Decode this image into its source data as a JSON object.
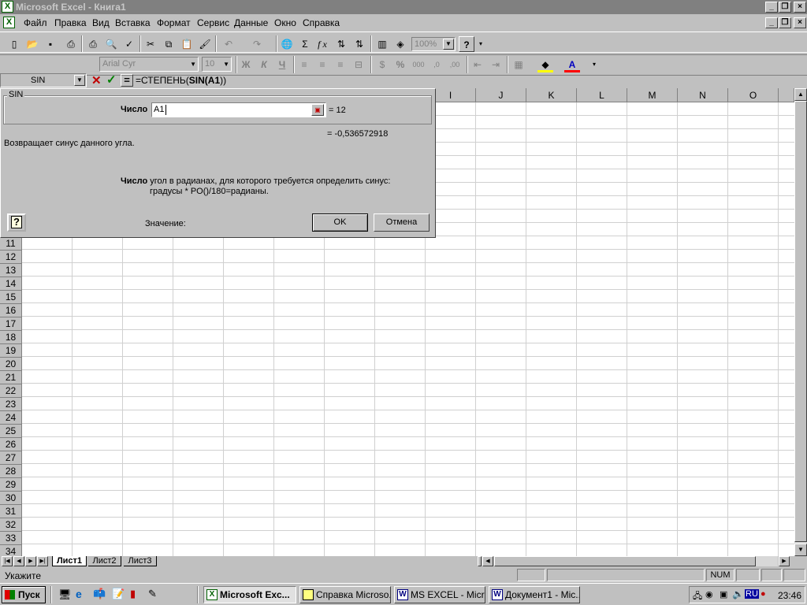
{
  "window": {
    "title": "Microsoft Excel - Книга1"
  },
  "menu": [
    "Файл",
    "Правка",
    "Вид",
    "Вставка",
    "Формат",
    "Сервис",
    "Данные",
    "Окно",
    "Справка"
  ],
  "toolbar": {
    "zoom": "100%",
    "font": "Arial Cyr",
    "size": "10",
    "bold": "Ж",
    "italic": "К",
    "underline": "Ч",
    "percent": "%",
    "thousands": "000",
    "sigma": "Σ",
    "fx": "f x"
  },
  "formula_bar": {
    "name_box": "SIN",
    "formula_prefix": "=СТЕПЕНЬ(",
    "formula_bold": "SIN(",
    "formula_arg": "A1",
    "formula_suffix": "))",
    "equals": "="
  },
  "dialog": {
    "group_label": "SIN",
    "arg_label": "Число",
    "arg_value": "A1",
    "arg_result": "= 12",
    "result": "= -0,536572918",
    "description": "Возвращает синус данного угла.",
    "arg_help_name": "Число",
    "arg_help_text": " угол в радианах, для которого требуется определить синус:",
    "arg_help_line2": "градусы * PO()/180=радианы.",
    "value_label": "Значение:",
    "ok": "OK",
    "cancel": "Отмена"
  },
  "columns": [
    "I",
    "J",
    "K",
    "L",
    "M",
    "N",
    "O"
  ],
  "rows": [
    "11",
    "12",
    "13",
    "14",
    "15",
    "16",
    "17",
    "18",
    "19",
    "20",
    "21",
    "22",
    "23",
    "24",
    "25",
    "26",
    "27",
    "28",
    "29",
    "30",
    "31",
    "32",
    "33",
    "34"
  ],
  "sheet_tabs": [
    "Лист1",
    "Лист2",
    "Лист3"
  ],
  "status": {
    "text": "Укажите",
    "num": "NUM"
  },
  "taskbar": {
    "start": "Пуск",
    "tasks": [
      "Microsoft Exc...",
      "Справка Microso...",
      "MS EXCEL - Micr...",
      "Документ1 - Mic..."
    ],
    "lang": "RU",
    "clock": "23:46"
  },
  "colors": {
    "title_inactive": "#808080",
    "face": "#c0c0c0",
    "green_check": "#008000",
    "red_x": "#c00000"
  }
}
